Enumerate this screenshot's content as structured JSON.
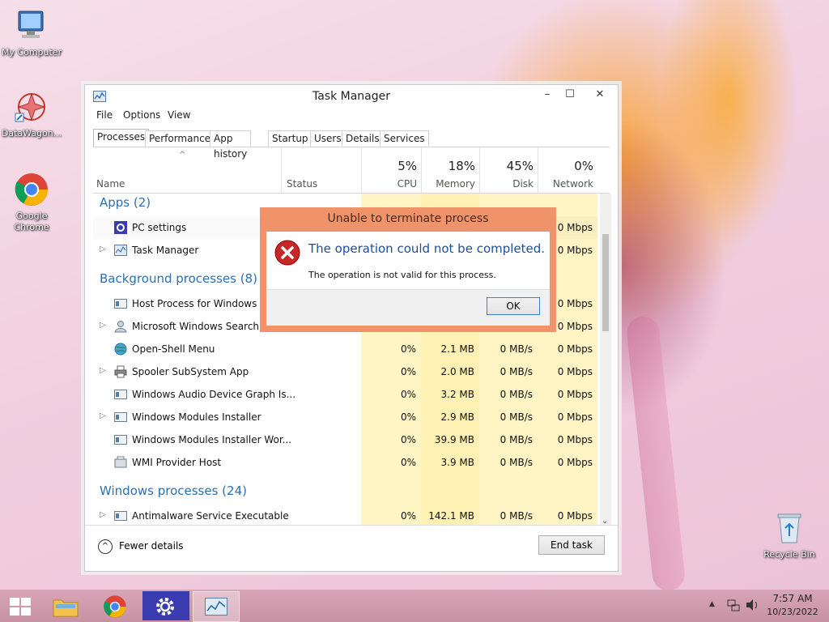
{
  "desktop": {
    "icons": [
      {
        "label": "My Computer"
      },
      {
        "label": "DataWagon..."
      },
      {
        "label": "Google Chrome"
      },
      {
        "label": "Recycle Bin"
      }
    ]
  },
  "window": {
    "title": "Task Manager",
    "controls": {
      "minimize": "–",
      "maximize": "☐",
      "close": "✕"
    },
    "menu": [
      "File",
      "Options",
      "View"
    ],
    "tabs": [
      "Processes",
      "Performance",
      "App history",
      "Startup",
      "Users",
      "Details",
      "Services"
    ],
    "active_tab": "Processes",
    "columns": {
      "name": "Name",
      "status": "Status",
      "cpu": {
        "pct": "5%",
        "label": "CPU"
      },
      "memory": {
        "pct": "18%",
        "label": "Memory"
      },
      "disk": {
        "pct": "45%",
        "label": "Disk"
      },
      "network": {
        "pct": "0%",
        "label": "Network"
      }
    },
    "groups": {
      "apps": "Apps (2)",
      "background": "Background processes (8)",
      "windows": "Windows processes (24)"
    },
    "rows": [
      {
        "name": "PC settings",
        "expand": "",
        "cpu": "",
        "memory": "",
        "disk": "",
        "network": "0 Mbps"
      },
      {
        "name": "Task Manager",
        "expand": "▷",
        "cpu": "",
        "memory": "",
        "disk": "",
        "network": "0 Mbps"
      },
      {
        "name": "Host Process for Windows Tas",
        "expand": "",
        "cpu": "",
        "memory": "",
        "disk": "",
        "network": "0 Mbps"
      },
      {
        "name": "Microsoft Windows Search Ind",
        "expand": "▷",
        "cpu": "",
        "memory": "",
        "disk": "",
        "network": "0 Mbps"
      },
      {
        "name": "Open-Shell Menu",
        "expand": "",
        "cpu": "0%",
        "memory": "2.1 MB",
        "disk": "0 MB/s",
        "network": "0 Mbps"
      },
      {
        "name": "Spooler SubSystem App",
        "expand": "▷",
        "cpu": "0%",
        "memory": "2.0 MB",
        "disk": "0 MB/s",
        "network": "0 Mbps"
      },
      {
        "name": "Windows Audio Device Graph Is...",
        "expand": "",
        "cpu": "0%",
        "memory": "3.2 MB",
        "disk": "0 MB/s",
        "network": "0 Mbps"
      },
      {
        "name": "Windows Modules Installer",
        "expand": "▷",
        "cpu": "0%",
        "memory": "2.9 MB",
        "disk": "0 MB/s",
        "network": "0 Mbps"
      },
      {
        "name": "Windows Modules Installer Wor...",
        "expand": "",
        "cpu": "0%",
        "memory": "39.9 MB",
        "disk": "0 MB/s",
        "network": "0 Mbps"
      },
      {
        "name": "WMI Provider Host",
        "expand": "",
        "cpu": "0%",
        "memory": "3.9 MB",
        "disk": "0 MB/s",
        "network": "0 Mbps"
      },
      {
        "name": "Antimalware Service Executable",
        "expand": "▷",
        "cpu": "0%",
        "memory": "142.1 MB",
        "disk": "0 MB/s",
        "network": "0 Mbps"
      }
    ],
    "footer": {
      "fewer_details": "Fewer details",
      "end_task": "End task"
    }
  },
  "dialog": {
    "title": "Unable to terminate process",
    "heading": "The operation could not be completed.",
    "message": "The operation is not valid for this process.",
    "ok": "OK"
  },
  "taskbar": {
    "clock_time": "7:57 AM",
    "clock_date": "10/23/2022",
    "tray_arrow": "▲"
  },
  "colors": {
    "accent": "#2a6fb0",
    "dialog_border": "#f0926a",
    "highlight_columns": "#fff4c4"
  }
}
